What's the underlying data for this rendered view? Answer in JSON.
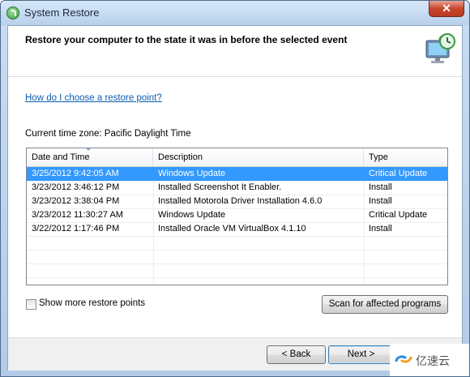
{
  "window": {
    "title": "System Restore",
    "close_glyph": "✕"
  },
  "header": {
    "title": "Restore your computer to the state it was in before the selected event"
  },
  "content": {
    "help_link": "How do I choose a restore point?",
    "timezone": "Current time zone: Pacific Daylight Time"
  },
  "table": {
    "columns": [
      "Date and Time",
      "Description",
      "Type"
    ],
    "rows": [
      {
        "date": "3/25/2012 9:42:05 AM",
        "description": "Windows Update",
        "type": "Critical Update",
        "selected": true
      },
      {
        "date": "3/23/2012 3:46:12 PM",
        "description": "Installed Screenshot It Enabler.",
        "type": "Install",
        "selected": false
      },
      {
        "date": "3/23/2012 3:38:04 PM",
        "description": "Installed Motorola Driver Installation 4.6.0",
        "type": "Install",
        "selected": false
      },
      {
        "date": "3/23/2012 11:30:27 AM",
        "description": "Windows Update",
        "type": "Critical Update",
        "selected": false
      },
      {
        "date": "3/22/2012 1:17:46 PM",
        "description": "Installed Oracle VM VirtualBox 4.1.10",
        "type": "Install",
        "selected": false
      }
    ]
  },
  "options": {
    "show_more_label": "Show more restore points",
    "show_more_checked": false,
    "scan_button": "Scan for affected programs"
  },
  "footer": {
    "back_button": "< Back",
    "next_button": "Next >"
  },
  "watermark": {
    "text": "亿速云"
  },
  "colors": {
    "selection": "#3399ff",
    "link": "#0b5db0",
    "titlebar": "#b9d0ec"
  }
}
